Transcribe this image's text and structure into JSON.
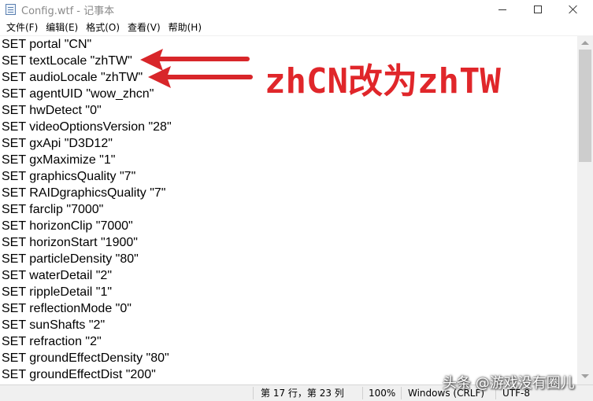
{
  "window": {
    "title": "Config.wtf - 记事本",
    "minimize_label": "—",
    "maximize_label": "□",
    "close_label": "✕"
  },
  "menu": {
    "items": [
      "文件(F)",
      "编辑(E)",
      "格式(O)",
      "查看(V)",
      "帮助(H)"
    ]
  },
  "editor": {
    "lines": [
      "SET portal \"CN\"",
      "SET textLocale \"zhTW\"",
      "SET audioLocale \"zhTW\"",
      "SET agentUID \"wow_zhcn\"",
      "SET hwDetect \"0\"",
      "SET videoOptionsVersion \"28\"",
      "SET gxApi \"D3D12\"",
      "SET gxMaximize \"1\"",
      "SET graphicsQuality \"7\"",
      "SET RAIDgraphicsQuality \"7\"",
      "SET farclip \"7000\"",
      "SET horizonClip \"7000\"",
      "SET horizonStart \"1900\"",
      "SET particleDensity \"80\"",
      "SET waterDetail \"2\"",
      "SET rippleDetail \"1\"",
      "SET reflectionMode \"0\"",
      "SET sunShafts \"2\"",
      "SET refraction \"2\"",
      "SET groundEffectDensity \"80\"",
      "SET groundEffectDist \"200\""
    ]
  },
  "status": {
    "position": "第 17 行，第 23 列",
    "zoom": "100%",
    "line_ending": "Windows (CRLF)",
    "encoding": "UTF-8"
  },
  "annotation": {
    "text": "zhCN改为zhTW",
    "color": "#e0262a",
    "icon": "arrow-left-icon"
  },
  "watermark": {
    "text": "头条 @游戏没有圈儿"
  }
}
